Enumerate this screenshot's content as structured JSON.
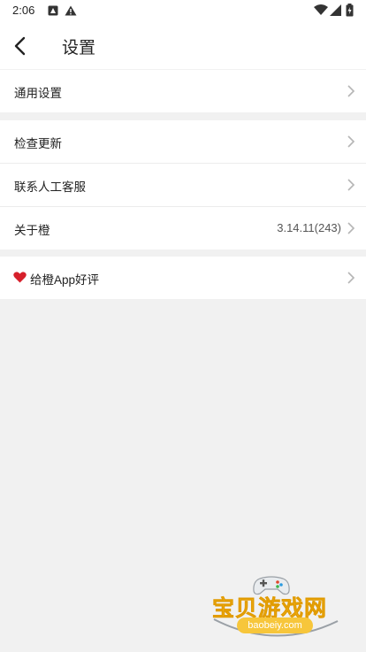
{
  "status_bar": {
    "time": "2:06"
  },
  "header": {
    "title": "设置"
  },
  "groups": {
    "general": {
      "label": "通用设置"
    },
    "support": {
      "check_update": "检查更新",
      "contact": "联系人工客服",
      "about_label": "关于橙",
      "about_version": "3.14.11(243)"
    },
    "rate": {
      "label": "给橙App好评"
    }
  },
  "watermark": {
    "title": "宝贝游戏网",
    "url": "baobeiy.com"
  },
  "colors": {
    "background": "#f1f1f1",
    "surface": "#ffffff",
    "heart": "#d6202b",
    "watermark": "#f6b51c"
  }
}
